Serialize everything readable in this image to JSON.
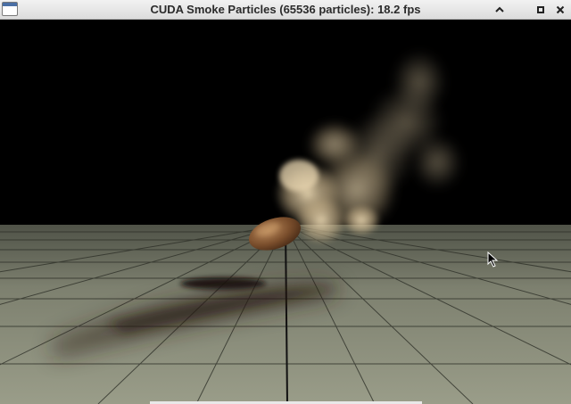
{
  "window": {
    "title": "CUDA Smoke Particles (65536 particles): 18.2 fps",
    "buttons": [
      {
        "name": "minimize-button",
        "icon": "chevron-up-icon"
      },
      {
        "name": "maximize-button",
        "icon": "square-icon"
      },
      {
        "name": "close-button",
        "icon": "close-icon"
      }
    ]
  },
  "scene": {
    "background": "#000000",
    "floor_color": "#8b8d7a",
    "smoke_color": "#d9c29a",
    "shadow_color": "#2b1f14"
  }
}
